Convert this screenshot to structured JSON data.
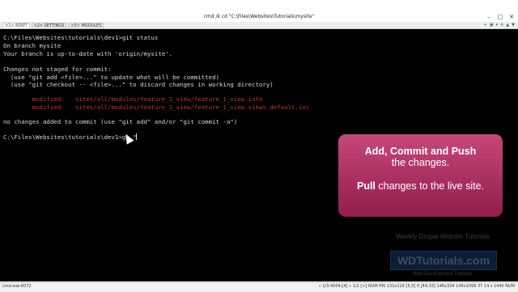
{
  "window": {
    "title": "cmd /k cd \"C:\\Files\\Websites\\Tutorials\\mysite\"",
    "controls": [
      "–",
      "□",
      "✕"
    ]
  },
  "tabs": [
    {
      "label": "<1> ROOT"
    },
    {
      "label": "<2> SETTINGS"
    },
    {
      "label": "<3> MODULES"
    }
  ],
  "tab_icons": [
    "+",
    "▣",
    "▾",
    "≡",
    "▲",
    "▼"
  ],
  "terminal": {
    "lines": [
      {
        "text": "C:\\Files\\Websites\\tutorials\\dev1>git status",
        "color": "normal"
      },
      {
        "text": "On branch mysite",
        "color": "normal"
      },
      {
        "text": "Your branch is up-to-date with 'origin/mysite'.",
        "color": "normal"
      },
      {
        "text": "",
        "color": "normal"
      },
      {
        "text": "Changes not staged for commit:",
        "color": "normal"
      },
      {
        "text": "  (use \"git add <file>...\" to update what will be committed)",
        "color": "normal"
      },
      {
        "text": "  (use \"git checkout -- <file>...\" to discard changes in working directory)",
        "color": "normal"
      },
      {
        "text": "",
        "color": "normal"
      },
      {
        "text": "        modified:   sites/all/modules/feature_1_view/feature_1_view.info",
        "color": "red"
      },
      {
        "text": "        modified:   sites/all/modules/feature_1_view/feature_1_view.views_default.inc",
        "color": "red"
      },
      {
        "text": "",
        "color": "normal"
      },
      {
        "text": "no changes added to commit (use \"git add\" and/or \"git commit -a\")",
        "color": "normal"
      },
      {
        "text": "",
        "color": "normal"
      },
      {
        "text": "C:\\Files\\Websites\\tutorials\\dev1>ga \"",
        "color": "normal"
      }
    ]
  },
  "callout": {
    "line1_bold": "Add, Commit and Push",
    "line1_rest": "the changes.",
    "line2_bold": "Pull",
    "line2_rest": " changes to the live site."
  },
  "watermark": {
    "top": "Weekly Drupal Website Tutorials",
    "logo": "WDTutorials.com",
    "bottom": "Web Development Tutorials"
  },
  "statusbar": {
    "left": "cmd.exe:6072",
    "right": "« 1/3:4004:[4] » 1/1 [+] NUM PRI 131x116 [5,0] 0 [44,33] 146x334 146x1099 37 14 ⏸ 1440 NUM"
  },
  "colors": {
    "terminal_bg": "#000000",
    "terminal_text": "#d8d8d8",
    "modified_text": "#c0392b",
    "callout_top": "#c8477a",
    "callout_bottom": "#8f1d4d"
  }
}
